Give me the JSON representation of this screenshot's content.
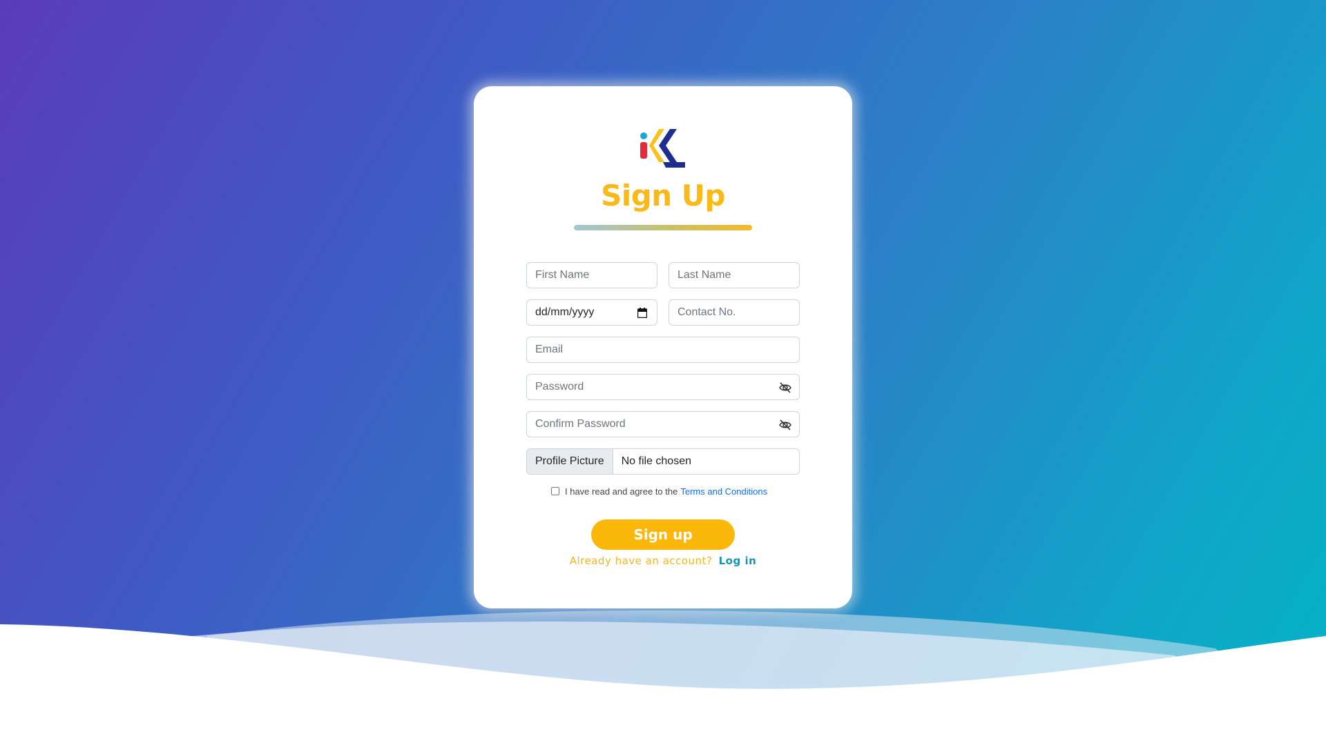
{
  "page": {
    "title": "Sign Up",
    "colors": {
      "accent": "#fcb80a",
      "title": "#fbb917",
      "link": "#0d6efd",
      "login_link": "#1694b5"
    }
  },
  "logo": {
    "icon": "ik-logo"
  },
  "form": {
    "first_name": {
      "placeholder": "First Name"
    },
    "last_name": {
      "placeholder": "Last Name"
    },
    "dob": {
      "value": "dd/mm/yyyy",
      "icon": "calendar-icon"
    },
    "contact": {
      "placeholder": "Contact No."
    },
    "email": {
      "placeholder": "Email"
    },
    "password": {
      "placeholder": "Password",
      "icon": "eye-slash-icon"
    },
    "confirm_password": {
      "placeholder": "Confirm Password",
      "icon": "eye-slash-icon"
    },
    "profile_picture": {
      "button_label": "Profile Picture",
      "status": "No file chosen"
    },
    "terms": {
      "checked": false,
      "text": "I have read and agree to the",
      "link": "Terms and Conditions"
    },
    "submit_label": "Sign up",
    "login_prompt": "Already have an account?",
    "login_link": "Log in"
  }
}
